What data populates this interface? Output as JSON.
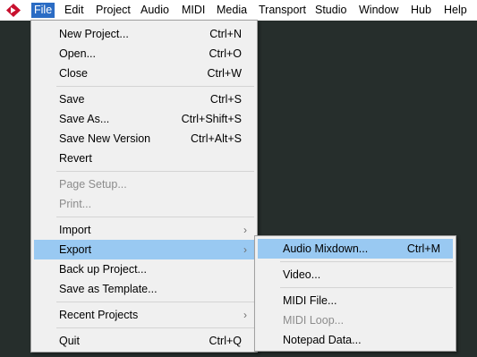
{
  "menubar": {
    "logo_icon": "cubase-logo-icon",
    "items": [
      "File",
      "Edit",
      "Project",
      "Audio",
      "MIDI",
      "Media",
      "Transport",
      "Studio",
      "Window",
      "Hub",
      "Help"
    ],
    "active_item": "File"
  },
  "file_menu": {
    "new_project": {
      "label": "New Project...",
      "shortcut": "Ctrl+N"
    },
    "open": {
      "label": "Open...",
      "shortcut": "Ctrl+O"
    },
    "close": {
      "label": "Close",
      "shortcut": "Ctrl+W"
    },
    "save": {
      "label": "Save",
      "shortcut": "Ctrl+S"
    },
    "save_as": {
      "label": "Save As...",
      "shortcut": "Ctrl+Shift+S"
    },
    "save_new_version": {
      "label": "Save New Version",
      "shortcut": "Ctrl+Alt+S"
    },
    "revert": {
      "label": "Revert"
    },
    "page_setup": {
      "label": "Page Setup...",
      "enabled": false
    },
    "print": {
      "label": "Print...",
      "enabled": false
    },
    "import": {
      "label": "Import",
      "submenu_icon": "chevron-right-icon"
    },
    "export": {
      "label": "Export",
      "submenu_icon": "chevron-right-icon",
      "highlighted": true
    },
    "back_up_project": {
      "label": "Back up Project..."
    },
    "save_as_template": {
      "label": "Save as Template..."
    },
    "recent_projects": {
      "label": "Recent Projects",
      "submenu_icon": "chevron-right-icon"
    },
    "quit": {
      "label": "Quit",
      "shortcut": "Ctrl+Q"
    }
  },
  "export_menu": {
    "audio_mixdown": {
      "label": "Audio Mixdown...",
      "shortcut": "Ctrl+M",
      "highlighted": true
    },
    "video": {
      "label": "Video..."
    },
    "midi_file": {
      "label": "MIDI File..."
    },
    "midi_loop": {
      "label": "MIDI Loop...",
      "enabled": false
    },
    "notepad_data": {
      "label": "Notepad Data..."
    }
  },
  "colors": {
    "background": "#262e2c",
    "menubar": "#ffffff",
    "menu_background": "#f0f0f0",
    "active_menu": "#2b6cc4",
    "highlight": "#99c9f2",
    "disabled_text": "#8c8c8c",
    "logo_red": "#c8102e"
  }
}
